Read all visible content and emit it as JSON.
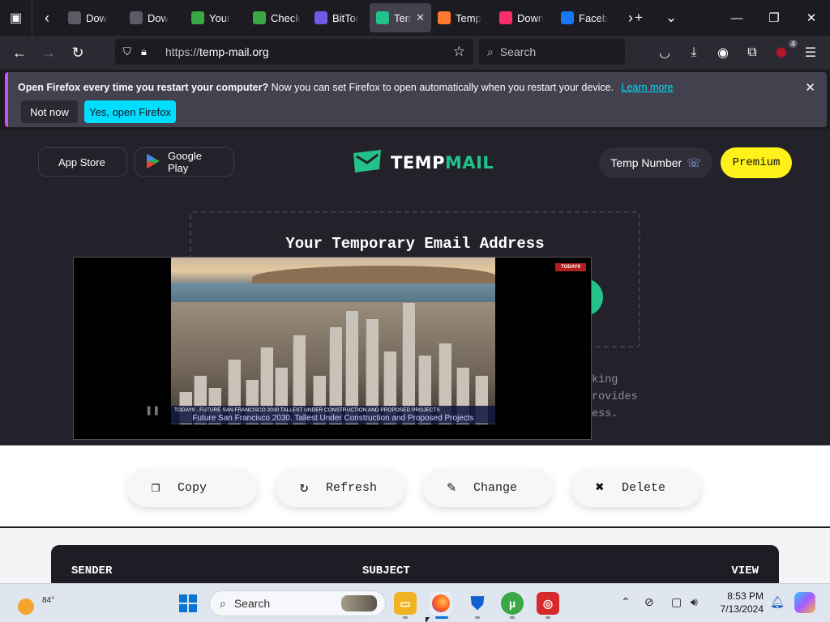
{
  "tabs": [
    {
      "title": "Dow",
      "favicon_color": "#5b5b66",
      "icon": "download-icon"
    },
    {
      "title": "Dow",
      "favicon_color": "#5b5b66",
      "icon": "zip-icon"
    },
    {
      "title": "Your",
      "favicon_color": "#3aa845",
      "icon": "utorrent-icon"
    },
    {
      "title": "Check",
      "favicon_color": "#3aa845",
      "icon": "utorrent-icon"
    },
    {
      "title": "BitTor",
      "favicon_color": "#6e5ae6",
      "icon": "bittorrent-icon"
    },
    {
      "title": "Tem",
      "favicon_color": "#21c38a",
      "icon": "tempmail-icon",
      "active": true
    },
    {
      "title": "Temp",
      "favicon_color": "#ff7a2e",
      "icon": "temp-icon"
    },
    {
      "title": "Down",
      "favicon_color": "#ff2c6a",
      "icon": "download-icon"
    },
    {
      "title": "Faceb",
      "favicon_color": "#1877f2",
      "icon": "facebook-icon"
    }
  ],
  "navbar": {
    "url_prefix": "https://",
    "url_host": "temp-mail.org",
    "search_placeholder": "Search",
    "extension_badge": "4"
  },
  "notification": {
    "bold_text": "Open Firefox every time you restart your computer?",
    "text": "Now you can set Firefox to open automatically when you restart your device.",
    "learn_more": "Learn more",
    "not_now": "Not now",
    "yes": "Yes, open Firefox"
  },
  "site": {
    "app_store": "App Store",
    "google_play": "Google Play",
    "logo_part1": "TEMP",
    "logo_part2": "MAIL",
    "temp_number": "Temp Number",
    "premium": "Premium",
    "heading": "Your Temporary Email Address",
    "desc_lines": [
      "king",
      "rovides",
      "ess."
    ],
    "actions": {
      "copy": "Copy",
      "refresh": "Refresh",
      "change": "Change",
      "delete": "Delete"
    },
    "inbox": {
      "sender": "SENDER",
      "subject": "SUBJECT",
      "view": "VIEW"
    }
  },
  "video": {
    "caption_top": "TODAY9 - FUTURE SAN FRANCISCO 2030 TALLEST UNDER CONSTRUCTION AND PROPOSED PROJECTS",
    "caption_sub": "Future San Francisco 2030. Tallest Under Construction and Proposed Projects",
    "channel_logo": "TODAY9"
  },
  "taskbar": {
    "temperature": "84°",
    "search_placeholder": "Search",
    "time": "8:53 PM",
    "date": "7/13/2024"
  }
}
